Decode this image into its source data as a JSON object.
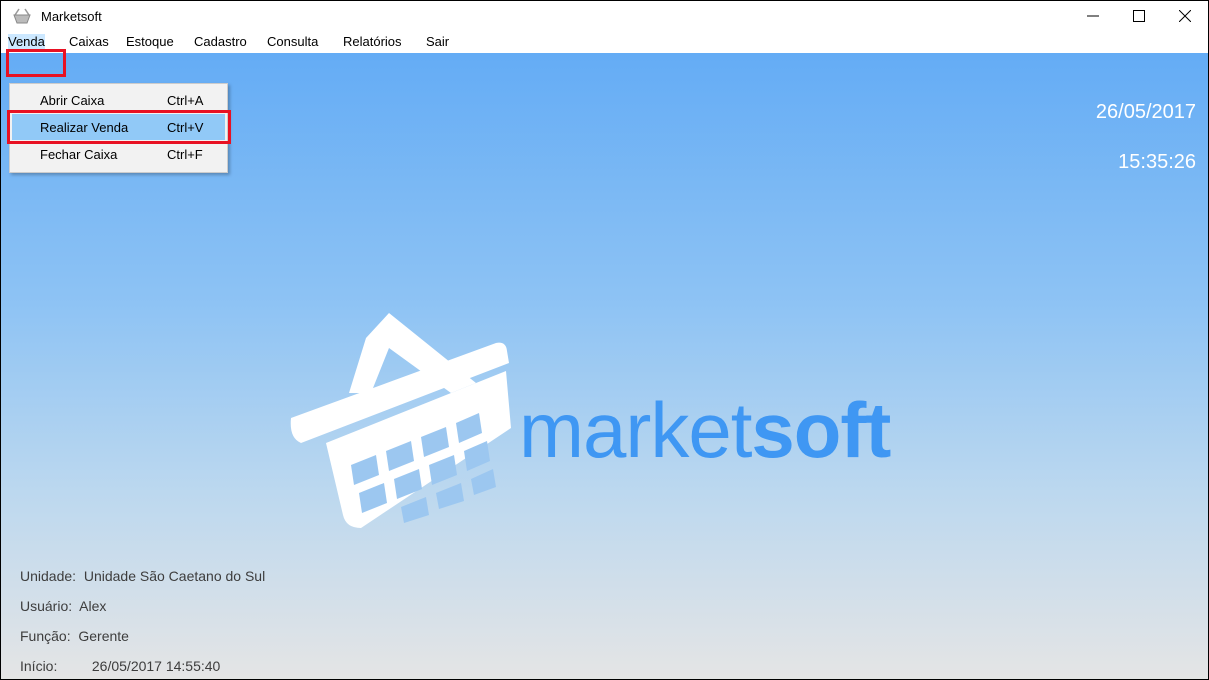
{
  "window": {
    "title": "Marketsoft",
    "icon": "basket-icon",
    "controls": [
      "minimize-icon",
      "maximize-icon",
      "close-icon"
    ]
  },
  "menu": {
    "items": [
      {
        "label": "Venda"
      },
      {
        "label": "Caixas"
      },
      {
        "label": "Estoque"
      },
      {
        "label": "Cadastro"
      },
      {
        "label": "Consulta"
      },
      {
        "label": "Relatórios"
      },
      {
        "label": "Sair"
      }
    ],
    "active": "Venda"
  },
  "dropdown": {
    "items": [
      {
        "label": "Abrir Caixa",
        "shortcut": "Ctrl+A"
      },
      {
        "label": "Realizar Venda",
        "shortcut": "Ctrl+V"
      },
      {
        "label": "Fechar Caixa",
        "shortcut": "Ctrl+F"
      }
    ],
    "highlighted": "Realizar Venda"
  },
  "clock": {
    "date": "26/05/2017",
    "time": "15:35:26"
  },
  "logo": {
    "text_regular": "market",
    "text_bold": "soft"
  },
  "info": {
    "unidade_label": "Unidade:",
    "unidade_value": "Unidade São Caetano do Sul",
    "usuario_label": "Usuário:",
    "usuario_value": "Alex",
    "funcao_label": "Função:",
    "funcao_value": "Gerente",
    "inicio_label": "Início:",
    "inicio_value": "26/05/2017 14:55:40"
  },
  "colors": {
    "highlight_box": "#e81123",
    "menu_hover": "#91c9f7",
    "logo_blue": "#3f97f3"
  }
}
